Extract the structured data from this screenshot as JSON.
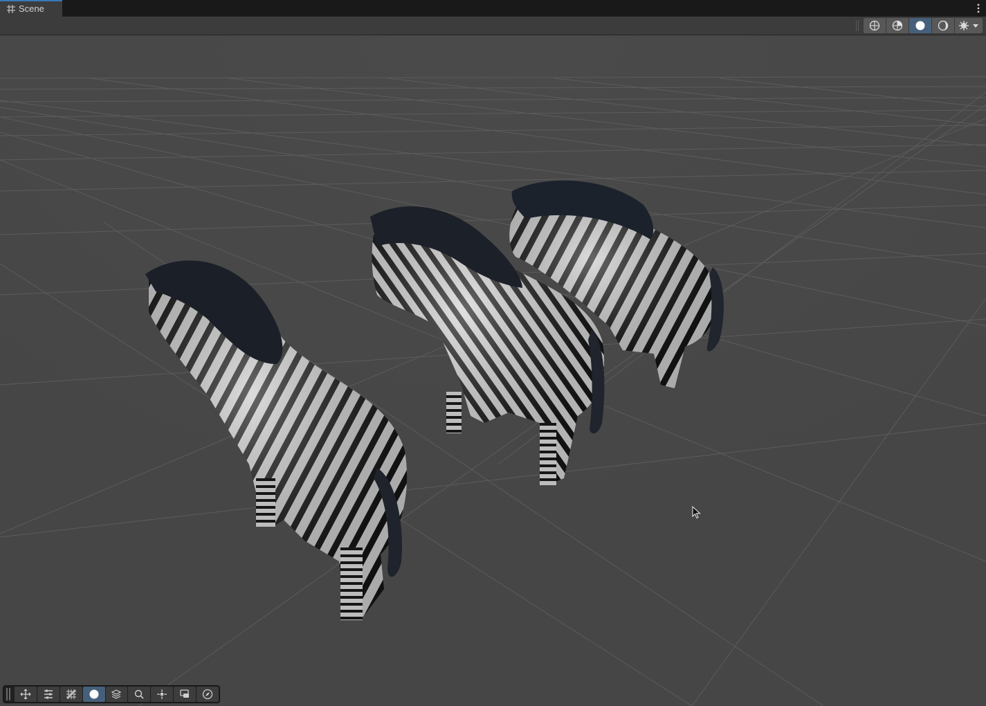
{
  "tab": {
    "title": "Scene",
    "icon": "grid-icon"
  },
  "scene_toolbar": {
    "buttons": [
      {
        "icon": "wireframe-icon",
        "active": false
      },
      {
        "icon": "shaded-wireframe-icon",
        "active": false
      },
      {
        "icon": "shaded-icon",
        "active": true
      },
      {
        "icon": "lit-icon",
        "active": false
      },
      {
        "icon": "debug-draw-icon",
        "active": false,
        "dropdown": true
      }
    ]
  },
  "scene": {
    "background_color": "#474747",
    "grid_color": "#5e5e5e",
    "objects": [
      "zebra",
      "zebra",
      "zebra"
    ]
  },
  "overlay_toolbar": {
    "buttons": [
      {
        "icon": "move-tool-icon",
        "active": false
      },
      {
        "icon": "transform-tool-icon",
        "active": false
      },
      {
        "icon": "grid-snap-icon",
        "active": false
      },
      {
        "icon": "sphere-view-icon",
        "active": true
      },
      {
        "icon": "layers-icon",
        "active": false
      },
      {
        "icon": "search-icon",
        "active": false
      },
      {
        "icon": "pivot-icon",
        "active": false
      },
      {
        "icon": "camera-icon",
        "active": false
      },
      {
        "icon": "compass-icon",
        "active": false
      }
    ]
  }
}
